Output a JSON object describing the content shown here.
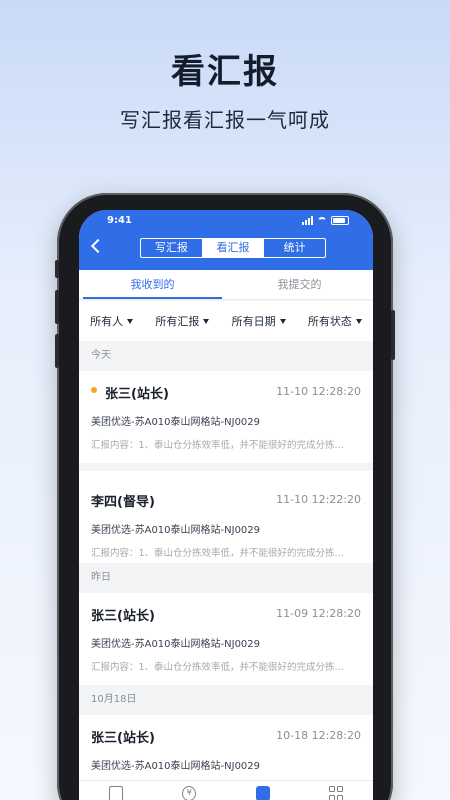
{
  "hero": {
    "title": "看汇报",
    "subtitle": "写汇报看汇报一气呵成"
  },
  "status_bar": {
    "time": "9:41"
  },
  "nav": {
    "segments": [
      "写汇报",
      "看汇报",
      "统计"
    ],
    "active_segment": "看汇报"
  },
  "subtabs": {
    "received": "我收到的",
    "submitted": "我提交的",
    "active": "我收到的"
  },
  "filters": [
    "所有人",
    "所有汇报",
    "所有日期",
    "所有状态"
  ],
  "sections": [
    {
      "label": "今天",
      "items": [
        {
          "name": "张三(站长)",
          "unread": true,
          "time": "11-10 12:28:20",
          "site": "美团优选-苏A010泰山网格站-NJ0029",
          "content": "汇报内容：1、泰山仓分拣效率低，并不能很好的完成分拣..."
        },
        {
          "name": "李四(督导)",
          "unread": false,
          "time": "11-10 12:22:20",
          "site": "美团优选-苏A010泰山网格站-NJ0029",
          "content": "汇报内容：1、泰山仓分拣效率低，并不能很好的完成分拣..."
        }
      ]
    },
    {
      "label": "昨日",
      "items": [
        {
          "name": "张三(站长)",
          "unread": false,
          "time": "11-09 12:28:20",
          "site": "美团优选-苏A010泰山网格站-NJ0029",
          "content": "汇报内容：1、泰山仓分拣效率低，并不能很好的完成分拣..."
        }
      ]
    },
    {
      "label": "10月18日",
      "items": [
        {
          "name": "张三(站长)",
          "unread": false,
          "time": "10-18 12:28:20",
          "site": "美团优选-苏A010泰山网格站-NJ0029",
          "content": ""
        }
      ]
    }
  ],
  "bottom_tabs": [
    {
      "icon": "document-icon"
    },
    {
      "icon": "yuan-icon",
      "glyph": "¥"
    },
    {
      "icon": "report-box-icon"
    },
    {
      "icon": "grid-icon"
    }
  ],
  "colors": {
    "primary": "#2f6ee6",
    "unread_dot": "#f5a623"
  }
}
